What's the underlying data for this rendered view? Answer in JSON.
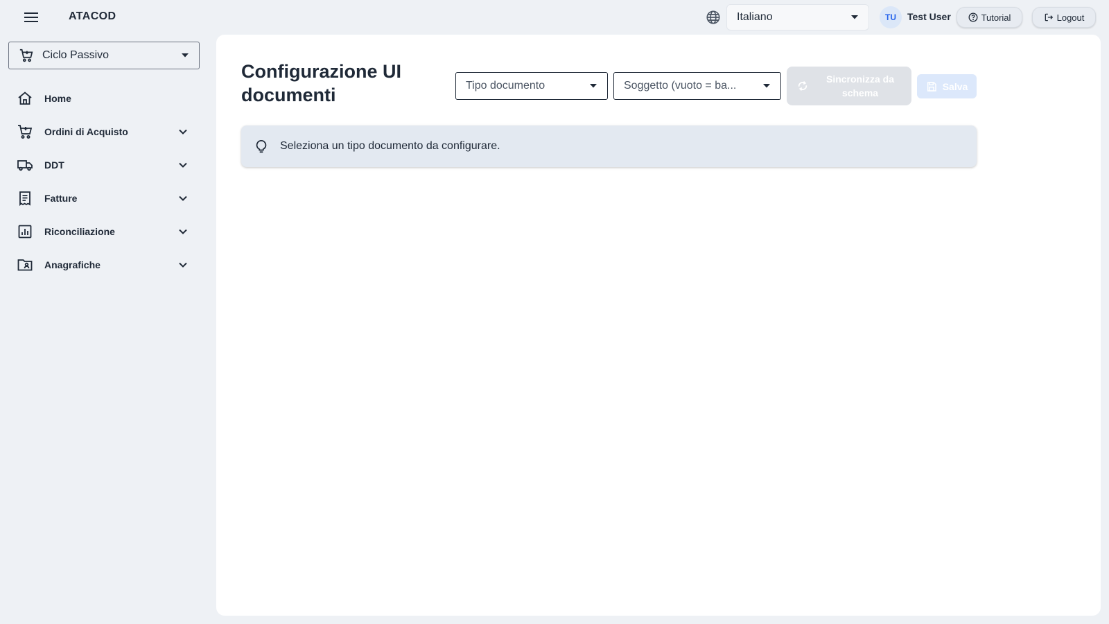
{
  "header": {
    "brand": "ATACOD",
    "language": "Italiano",
    "user_initials": "TU",
    "user_name": "Test User",
    "tutorial_label": "Tutorial",
    "logout_label": "Logout"
  },
  "sidebar": {
    "cycle": "Ciclo Passivo",
    "items": [
      {
        "label": "Home",
        "icon": "home-icon",
        "expandable": false
      },
      {
        "label": "Ordini di Acquisto",
        "icon": "cart-icon",
        "expandable": true
      },
      {
        "label": "DDT",
        "icon": "truck-icon",
        "expandable": true
      },
      {
        "label": "Fatture",
        "icon": "invoice-icon",
        "expandable": true
      },
      {
        "label": "Riconciliazione",
        "icon": "chart-icon",
        "expandable": true
      },
      {
        "label": "Anagrafiche",
        "icon": "folder-contact-icon",
        "expandable": true
      }
    ]
  },
  "main": {
    "title": "Configurazione UI documenti",
    "tipo_documento_placeholder": "Tipo documento",
    "soggetto_placeholder": "Soggetto (vuoto = ba...",
    "sync_label": "Sincronizza da schema",
    "save_label": "Salva",
    "info_message": "Seleziona un tipo documento da configurare."
  },
  "colors": {
    "page_background": "#eef1f5",
    "panel_background": "#ffffff",
    "accent": "#2563eb",
    "info_background": "#e3e9f1"
  }
}
